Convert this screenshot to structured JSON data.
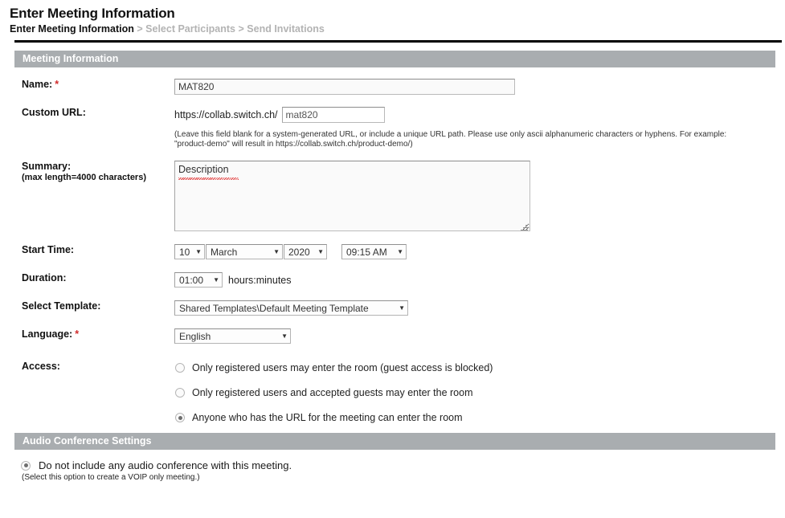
{
  "page": {
    "title": "Enter Meeting Information",
    "breadcrumb": {
      "step1": "Enter Meeting Information",
      "sep1": ">",
      "step2": "Select Participants",
      "sep2": ">",
      "step3": "Send Invitations"
    }
  },
  "sections": {
    "meeting_information": "Meeting Information",
    "audio_conference_settings": "Audio Conference Settings"
  },
  "fields": {
    "name": {
      "label": "Name:",
      "required_marker": "*",
      "value": "MAT820"
    },
    "custom_url": {
      "label": "Custom URL:",
      "prefix": "https://collab.switch.ch/",
      "value": "mat820",
      "helper": "(Leave this field blank for a system-generated URL, or include a unique URL path. Please use only ascii alphanumeric characters or hyphens. For example: \"product-demo\" will result in https://collab.switch.ch/product-demo/)"
    },
    "summary": {
      "label": "Summary:",
      "sublabel": "(max length=4000 characters)",
      "value": "Description"
    },
    "start_time": {
      "label": "Start Time:",
      "day": "10",
      "month": "March",
      "year": "2020",
      "time": "09:15 AM"
    },
    "duration": {
      "label": "Duration:",
      "value": "01:00",
      "unit": "hours:minutes"
    },
    "template": {
      "label": "Select Template:",
      "value": "Shared Templates\\Default Meeting Template"
    },
    "language": {
      "label": "Language:",
      "required_marker": "*",
      "value": "English"
    },
    "access": {
      "label": "Access:",
      "options": [
        {
          "text": "Only registered users may enter the room (guest access is blocked)",
          "selected": false
        },
        {
          "text": "Only registered users and accepted guests may enter the room",
          "selected": false
        },
        {
          "text": "Anyone who has the URL for the meeting can enter the room",
          "selected": true
        }
      ]
    }
  },
  "audio": {
    "option_label": "Do not include any audio conference with this meeting.",
    "option_note": "(Select this option to create a VOIP only meeting.)",
    "selected": true
  },
  "icons": {
    "caret": "▼"
  },
  "colors": {
    "section_bar": "#a9adb0",
    "required": "#d02b2b",
    "breadcrumb_inactive": "#b3b3b3",
    "rule": "#000000"
  }
}
